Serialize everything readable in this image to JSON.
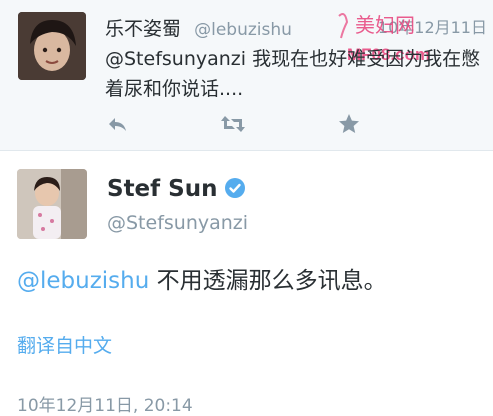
{
  "reply_tweet": {
    "author_name": "乐不姿蜀",
    "author_handle": "@lebuzishu",
    "date": "10年12月11日",
    "text": "@Stefsunyanzi 我现在也好难受因为我在憋着尿和你说话....",
    "actions": [
      {
        "name": "reply-icon"
      },
      {
        "name": "retweet-icon"
      },
      {
        "name": "favorite-icon"
      }
    ]
  },
  "watermark": {
    "line1": "美妇网",
    "line2": "MF08.com"
  },
  "main_tweet": {
    "author_name": "Stef Sun",
    "verified_icon": "verified-badge-icon",
    "author_handle": "@Stefsunyanzi",
    "mention": "@lebuzishu",
    "text": " 不用透漏那么多讯息。",
    "translate_link": "翻译自中文",
    "timestamp": "10年12月11日, 20:14"
  },
  "colors": {
    "accent": "#55acee",
    "muted": "#8899a6",
    "text": "#292f33",
    "reply_bg": "#f5f8fa"
  }
}
